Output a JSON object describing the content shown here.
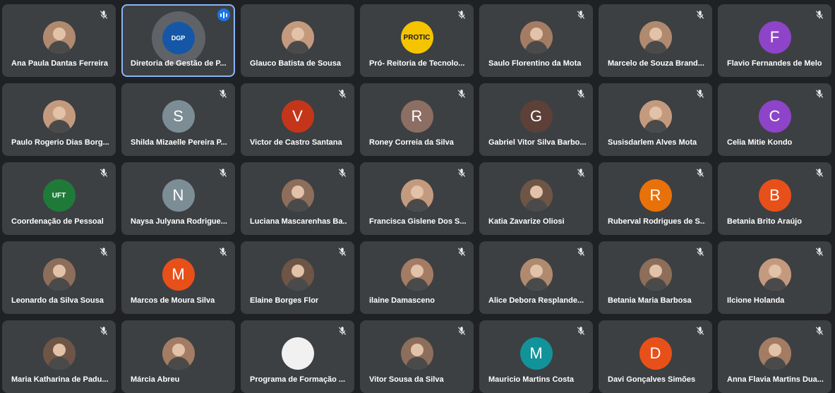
{
  "colors": {
    "background": "#202124",
    "tile": "#3c4043",
    "active_border": "#8ab4f8",
    "activity_badge": "#1a73e8"
  },
  "participants": [
    {
      "name": "Ana Paula Dantas Ferreira",
      "avatar": "photo",
      "muted": true
    },
    {
      "name": "Diretoria de Gestão de P...",
      "avatar": "logo",
      "initial": "DGP",
      "speaking": true,
      "muted": false
    },
    {
      "name": "Glauco Batista de Sousa",
      "avatar": "photo",
      "muted": false
    },
    {
      "name": "Pró- Reitoria de Tecnolo...",
      "avatar": "logo",
      "initial": "PROTIC",
      "color": "#f5c400",
      "muted": true
    },
    {
      "name": "Saulo Florentino da Mota",
      "avatar": "photo",
      "muted": true
    },
    {
      "name": "Marcelo de Souza Brand...",
      "avatar": "photo",
      "muted": true
    },
    {
      "name": "Flavio Fernandes de Melo",
      "avatar": "letter",
      "initial": "F",
      "color": "#8e44c8",
      "muted": true
    },
    {
      "name": "Paulo Rogerio Dias Borg...",
      "avatar": "photo",
      "muted": false
    },
    {
      "name": "Shilda Mizaelle Pereira P...",
      "avatar": "letter",
      "initial": "S",
      "color": "#7c8d96",
      "muted": true
    },
    {
      "name": "Victor de Castro Santana",
      "avatar": "letter",
      "initial": "V",
      "color": "#c5351a",
      "muted": true
    },
    {
      "name": "Roney Correia da Silva",
      "avatar": "letter",
      "initial": "R",
      "color": "#8d6e63",
      "muted": true
    },
    {
      "name": "Gabriel Vitor Silva Barbo...",
      "avatar": "letter",
      "initial": "G",
      "color": "#5d4037",
      "muted": true
    },
    {
      "name": "Susisdarlem Alves Mota",
      "avatar": "photo",
      "muted": true
    },
    {
      "name": "Celia Mitie Kondo",
      "avatar": "letter",
      "initial": "C",
      "color": "#8e44c8",
      "muted": true
    },
    {
      "name": "Coordenação de Pessoal",
      "avatar": "logo",
      "initial": "UFT",
      "color": "#1f7a3a",
      "muted": true
    },
    {
      "name": "Naysa Julyana Rodrigue...",
      "avatar": "letter",
      "initial": "N",
      "color": "#7c8d96",
      "muted": true
    },
    {
      "name": "Luciana Mascarenhas Ba...",
      "avatar": "photo",
      "muted": true
    },
    {
      "name": "Francisca Gislene Dos S...",
      "avatar": "photo",
      "muted": true
    },
    {
      "name": "Katia Zavarize Oliosi",
      "avatar": "photo",
      "muted": true
    },
    {
      "name": "Ruberval Rodrigues de S...",
      "avatar": "letter",
      "initial": "R",
      "color": "#e8710a",
      "muted": true
    },
    {
      "name": "Betania Brito Araújo",
      "avatar": "letter",
      "initial": "B",
      "color": "#e8501a",
      "muted": true
    },
    {
      "name": "Leonardo da Silva Sousa",
      "avatar": "photo",
      "muted": true
    },
    {
      "name": "Marcos de Moura Silva",
      "avatar": "letter",
      "initial": "M",
      "color": "#e8501a",
      "muted": true
    },
    {
      "name": "Elaine Borges Flor",
      "avatar": "photo",
      "muted": true
    },
    {
      "name": "ilaine Damasceno",
      "avatar": "photo",
      "muted": true
    },
    {
      "name": "Alice Debora Resplande...",
      "avatar": "photo",
      "muted": true
    },
    {
      "name": "Betania Maria Barbosa",
      "avatar": "photo",
      "muted": true
    },
    {
      "name": "Ilcione Holanda",
      "avatar": "photo",
      "muted": true
    },
    {
      "name": "Maria Katharina de Padu...",
      "avatar": "photo",
      "muted": true
    },
    {
      "name": "Márcia Abreu",
      "avatar": "photo",
      "muted": false
    },
    {
      "name": "Programa de Formação ...",
      "avatar": "logo",
      "initial": "",
      "color": "#f1f1f1",
      "muted": true
    },
    {
      "name": "Vitor Sousa da Silva",
      "avatar": "photo",
      "muted": true
    },
    {
      "name": "Mauricio Martins Costa",
      "avatar": "letter",
      "initial": "M",
      "color": "#12939a",
      "muted": true
    },
    {
      "name": "Davi Gonçalves Simões",
      "avatar": "letter",
      "initial": "D",
      "color": "#e8501a",
      "muted": true
    },
    {
      "name": "Anna Flavia Martins Dua...",
      "avatar": "photo",
      "muted": true
    }
  ]
}
